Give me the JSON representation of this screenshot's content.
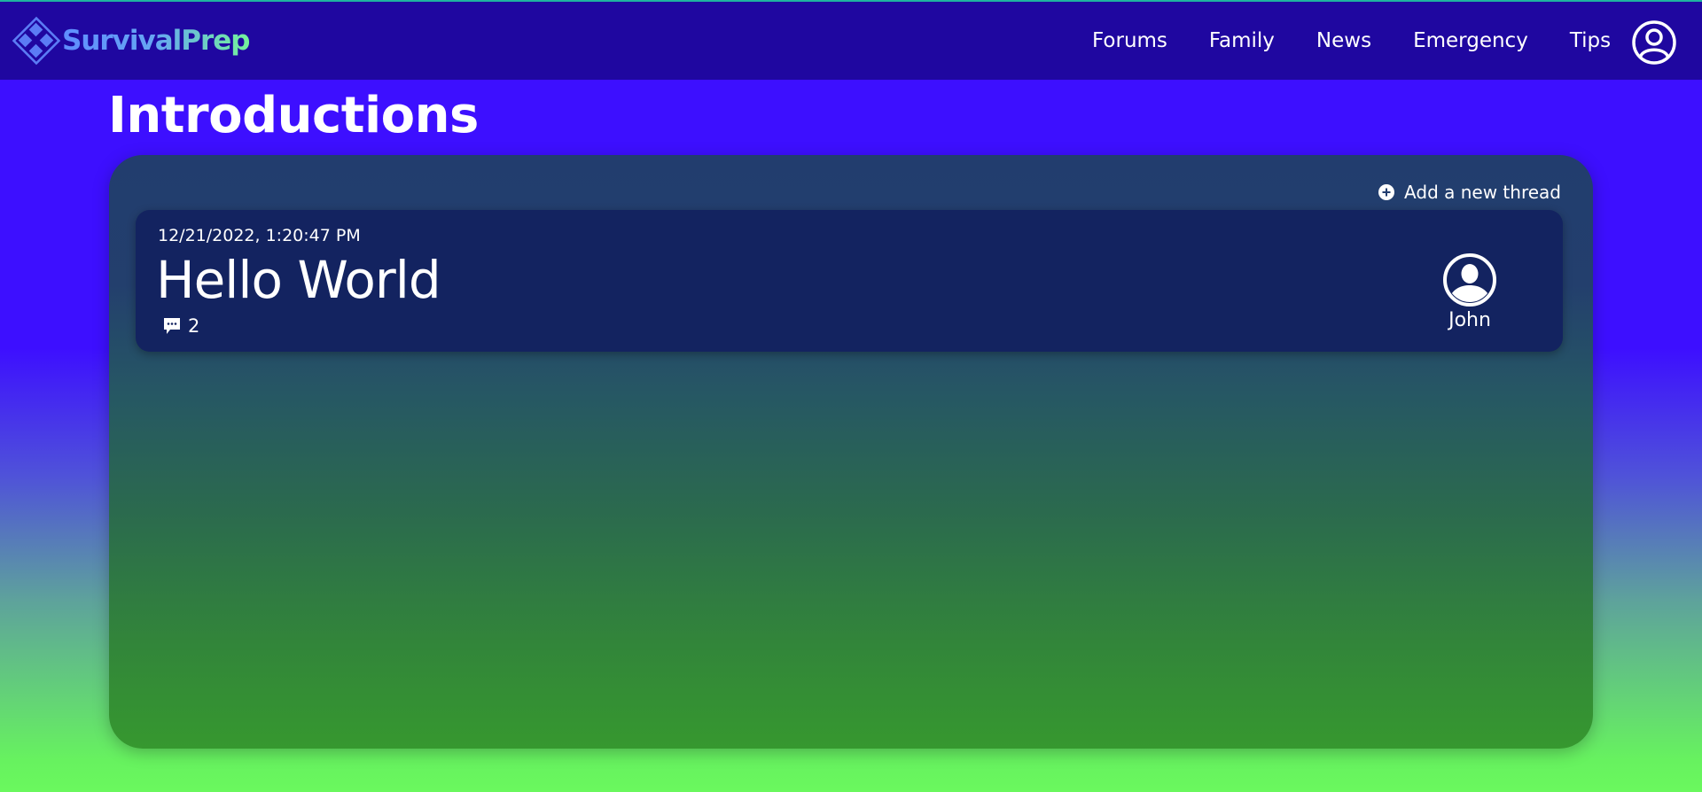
{
  "brand": {
    "name": "SurvivalPrep",
    "logo_icon": "diamond-grid-logo"
  },
  "nav": {
    "items": [
      {
        "label": "Forums"
      },
      {
        "label": "Family"
      },
      {
        "label": "News"
      },
      {
        "label": "Emergency"
      },
      {
        "label": "Tips"
      }
    ],
    "profile_icon": "user-circle-icon"
  },
  "page": {
    "title": "Introductions"
  },
  "panel": {
    "add_thread_label": "Add a new thread",
    "add_thread_icon": "plus-circle-icon",
    "threads": [
      {
        "date": "12/21/2022, 1:20:47 PM",
        "title": "Hello World",
        "comment_count": "2",
        "comment_icon": "speech-bubble-icon",
        "author": "John",
        "author_icon": "user-avatar-icon"
      }
    ]
  },
  "colors": {
    "navbar": "#1f07a0",
    "background_top": "#3d0fff",
    "background_bottom": "#6af85e",
    "panel_top": "#223d6e",
    "panel_bottom": "#36982f",
    "thread_card": "#132360",
    "brand_gradient_start": "#5f8cff",
    "brand_gradient_end": "#74f39a"
  }
}
